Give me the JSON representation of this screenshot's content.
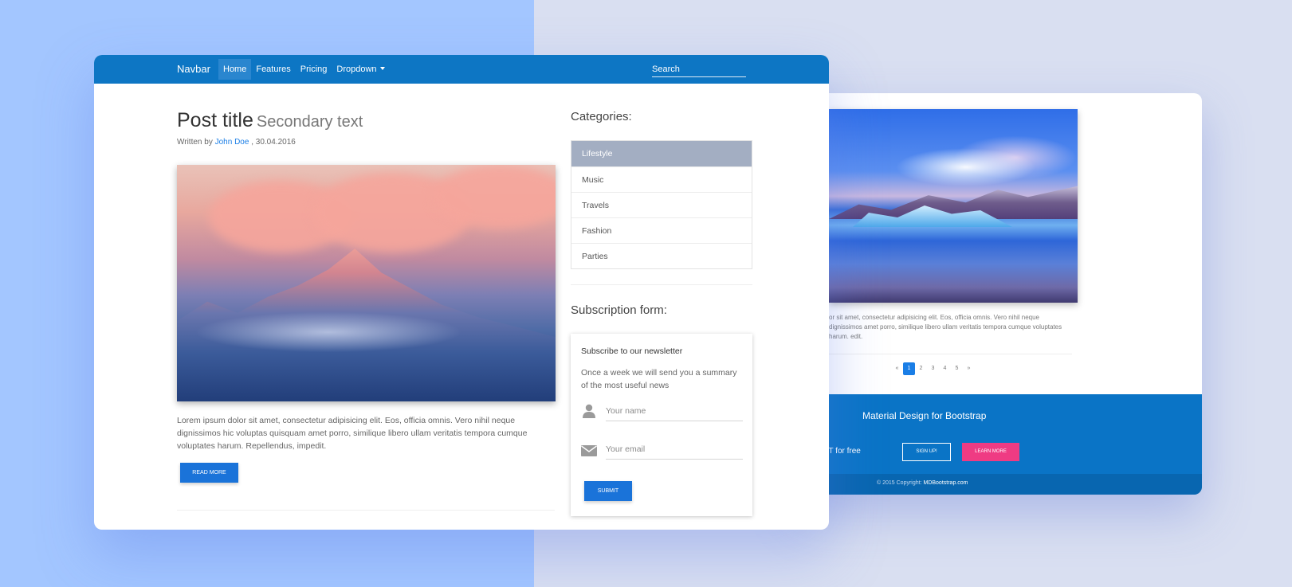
{
  "main_window": {
    "navbar": {
      "brand": "Navbar",
      "items": [
        {
          "label": "Home",
          "active": true
        },
        {
          "label": "Features"
        },
        {
          "label": "Pricing"
        },
        {
          "label": "Dropdown"
        }
      ],
      "search_placeholder": "Search"
    },
    "post": {
      "title": "Post title",
      "secondary": "Secondary text",
      "byline_prefix": "Written by",
      "author": "John Doe",
      "date": ", 30.04.2016",
      "body": "Lorem ipsum dolor sit amet, consectetur adipisicing elit. Eos, officia omnis. Vero nihil neque dignissimos hic voluptas quisquam amet porro, similique libero ullam veritatis tempora cumque voluptates harum. Repellendus, impedit.",
      "read_more": "READ MORE"
    },
    "sidebar": {
      "categories_title": "Categories:",
      "categories": [
        {
          "label": "Lifestyle",
          "active": true
        },
        {
          "label": "Music"
        },
        {
          "label": "Travels"
        },
        {
          "label": "Fashion"
        },
        {
          "label": "Parties"
        }
      ],
      "subscription_title": "Subscription form:",
      "card_title": "Subscribe to our newsletter",
      "card_text": "Once a week we will send you a summary of the most useful news",
      "name_placeholder": "Your name",
      "email_placeholder": "Your email",
      "submit": "SUBMIT"
    }
  },
  "back_window": {
    "text": "or sit amet, consectetur adipisicing elit. Eos, officia omnis. Vero nihil neque dignissimos amet porro, similique libero ullam veritatis tempora cumque voluptates harum. edit.",
    "pagination": [
      "«",
      "1",
      "2",
      "3",
      "4",
      "5",
      "»"
    ],
    "pagination_active": "1",
    "footer": {
      "title": "Material Design for Bootstrap",
      "kit_text": "our UI KIT for free",
      "signup": "SIGN UP!",
      "learn_more": "LEARN MORE",
      "copyright": "© 2015 Copyright:",
      "copyright_link": "MDBootstrap.com"
    }
  },
  "colors": {
    "navbar": "#0d76c4",
    "primary_button": "#1a73d9",
    "accent_pink": "#ef3b83",
    "active_category": "#a3aec2",
    "bg_left": "#a3c6ff",
    "bg_right": "#d9dff1"
  }
}
